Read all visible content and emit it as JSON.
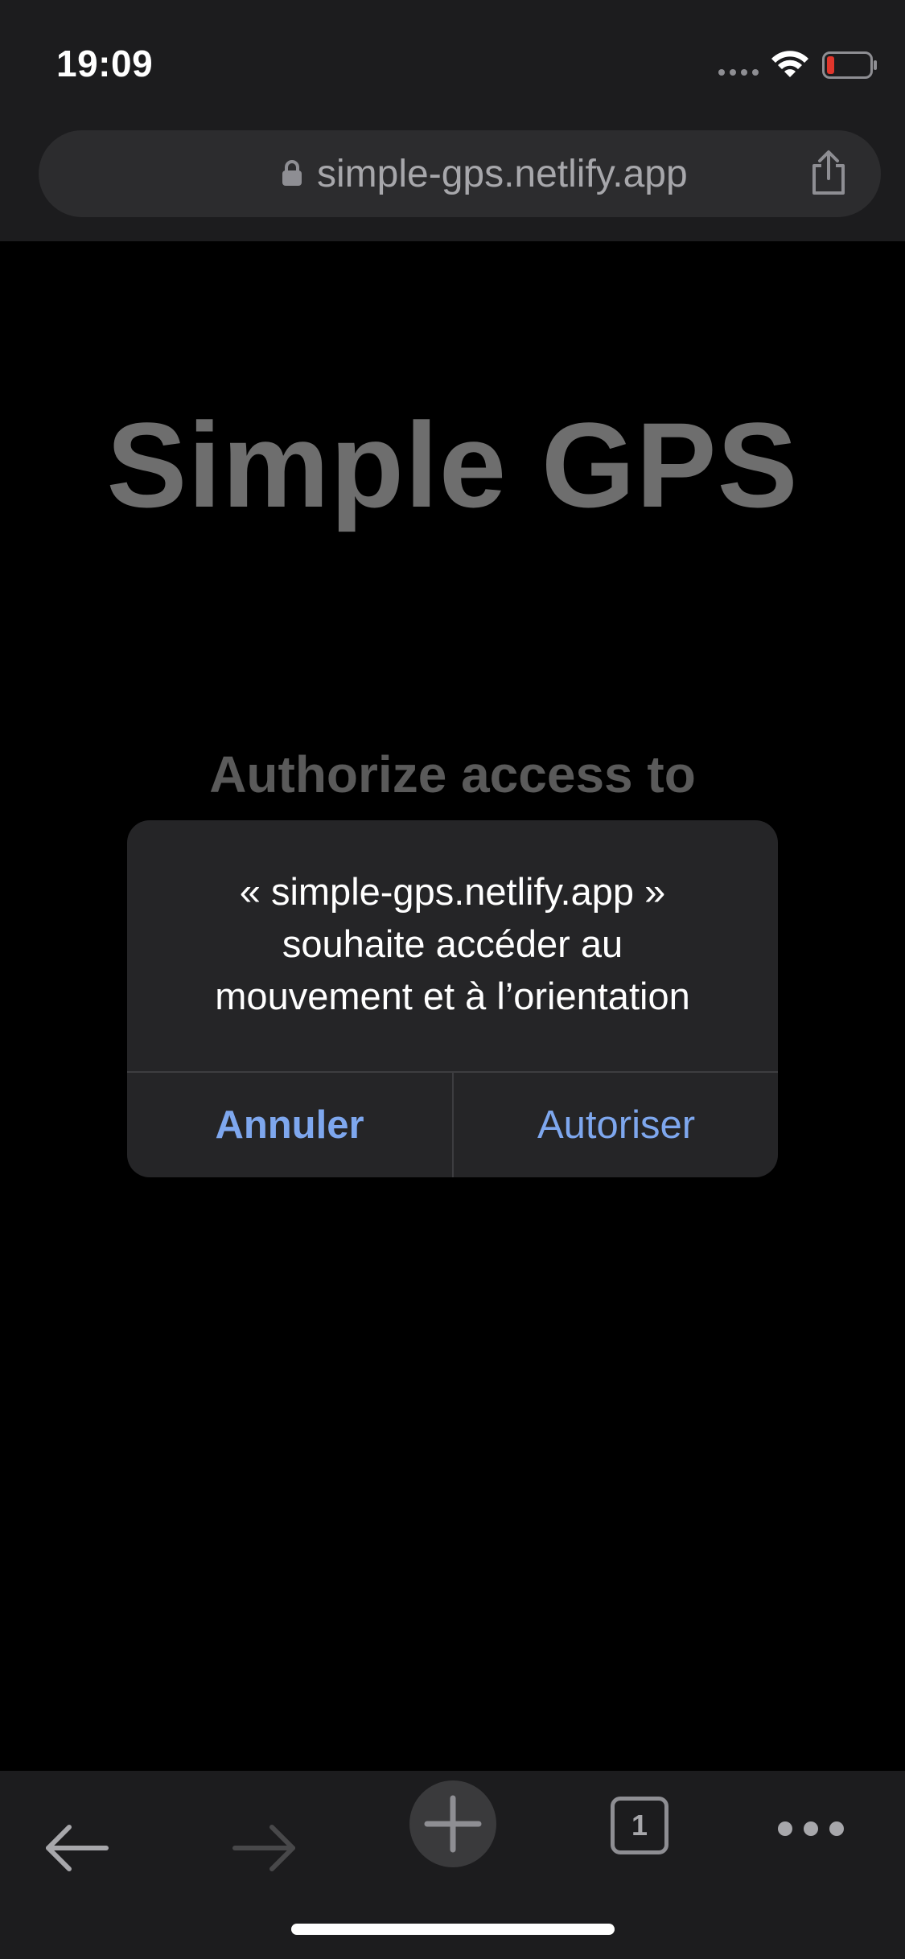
{
  "status_bar": {
    "time": "19:09",
    "icons": [
      "signal-dots-icon",
      "wifi-icon",
      "battery-low-icon"
    ],
    "battery_color": "#e0362c"
  },
  "browser": {
    "url": "simple-gps.netlify.app",
    "icons": [
      "lock-icon",
      "share-icon"
    ]
  },
  "page": {
    "title": "Simple GPS",
    "subtitle": "Authorize access to"
  },
  "dialog": {
    "message_lines": [
      "« simple-gps.netlify.app »",
      "souhaite accéder au",
      "mouvement et à l’orientation"
    ],
    "cancel_label": "Annuler",
    "allow_label": "Autoriser",
    "accent_color": "#7ea7ee"
  },
  "toolbar": {
    "tab_count": "1",
    "icons": [
      "back-arrow-icon",
      "forward-arrow-icon",
      "plus-icon",
      "tabs-icon",
      "more-icon"
    ]
  }
}
